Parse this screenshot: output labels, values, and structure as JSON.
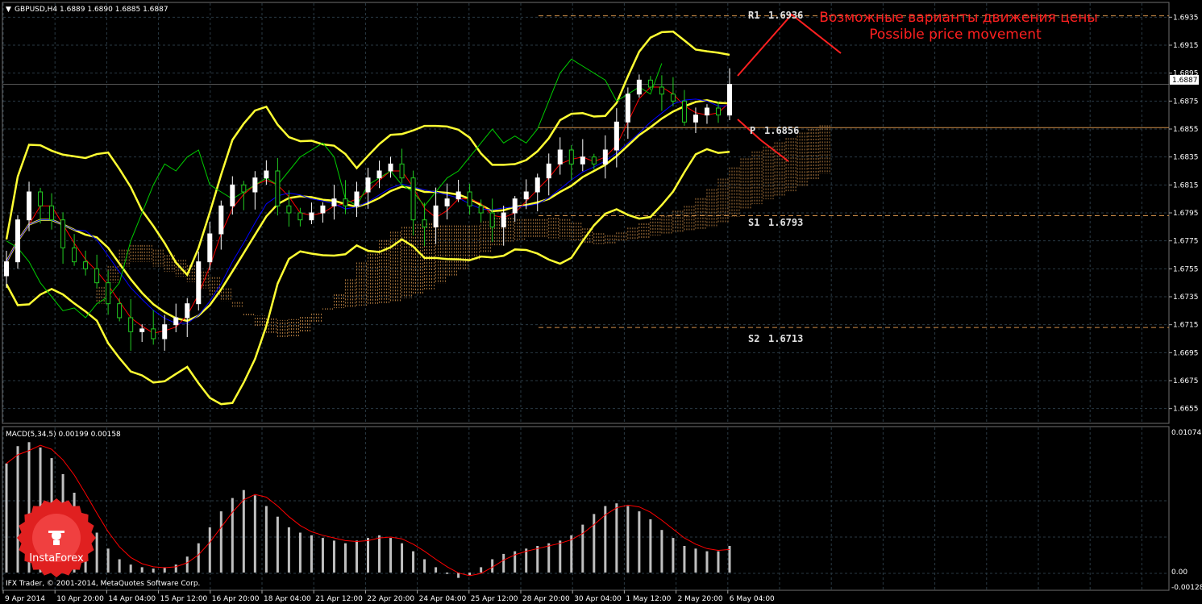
{
  "header": {
    "symbol_info": "GBPUSD,H4  1.6889 1.6890 1.6885 1.6887",
    "menu_glyph": "▼"
  },
  "annotation": {
    "ru": "Возможные варианты движения цены",
    "en": "Possible price movement"
  },
  "levels": [
    {
      "label": "R1",
      "value": "1.6936",
      "price": 1.6936
    },
    {
      "label": "P",
      "value": "1.6856",
      "price": 1.6856
    },
    {
      "label": "S1",
      "value": "1.6793",
      "price": 1.6793
    },
    {
      "label": "S2",
      "value": "1.6713",
      "price": 1.6713
    }
  ],
  "price_axis": {
    "ticks": [
      "1.6935",
      "1.6915",
      "1.6895",
      "1.6875",
      "1.6855",
      "1.6835",
      "1.6815",
      "1.6795",
      "1.6775",
      "1.6755",
      "1.6735",
      "1.6715",
      "1.6695",
      "1.6675",
      "1.6655"
    ],
    "current_price": "1.6887"
  },
  "macd": {
    "label": "MACD(5,34,5) 0.00199 0.00158",
    "axis_max": "0.01074",
    "axis_zero": "0.00",
    "axis_min": "-0.00128"
  },
  "time_axis": [
    "9 Apr 2014",
    "10 Apr 20:00",
    "14 Apr 04:00",
    "15 Apr 12:00",
    "16 Apr 20:00",
    "18 Apr 04:00",
    "21 Apr 12:00",
    "22 Apr 20:00",
    "24 Apr 04:00",
    "25 Apr 12:00",
    "28 Apr 20:00",
    "30 Apr 04:00",
    "1 May 12:00",
    "2 May 20:00",
    "6 May 04:00"
  ],
  "footer": "IFX Trader, © 2001-2014, MetaQuotes Software Corp.",
  "logo": {
    "text": "InstaForex"
  },
  "colors": {
    "background": "#000000",
    "grid": "#2a3a44",
    "bull": "#ffffff",
    "bear": "#22cc22",
    "bollinger": "#ffff33",
    "kijun": "#0000ff",
    "tenkan": "#ff0000",
    "chikou": "#00cc00",
    "cloud": "#d2914a",
    "macd_hist": "#c0c0c0",
    "macd_signal": "#ff0000",
    "annotation": "#ff2020",
    "level_line": "#d2914a"
  },
  "chart_data": {
    "type": "candlestick",
    "symbol": "GBPUSD",
    "timeframe": "H4",
    "ylim": [
      1.6645,
      1.6945
    ],
    "close_path": [
      1.676,
      1.679,
      1.681,
      1.68,
      1.679,
      1.677,
      1.676,
      1.6755,
      1.6745,
      1.673,
      1.672,
      1.671,
      1.6712,
      1.6705,
      1.6715,
      1.672,
      1.673,
      1.676,
      1.678,
      1.68,
      1.6815,
      1.681,
      1.682,
      1.6825,
      1.68,
      1.6795,
      1.679,
      1.6795,
      1.68,
      1.6805,
      1.68,
      1.681,
      1.682,
      1.6825,
      1.683,
      1.682,
      1.679,
      1.6785,
      1.68,
      1.6805,
      1.681,
      1.68,
      1.6795,
      1.6785,
      1.6795,
      1.6805,
      1.681,
      1.682,
      1.683,
      1.684,
      1.683,
      1.6835,
      1.683,
      1.684,
      1.686,
      1.688,
      1.689,
      1.6885,
      1.688,
      1.6875,
      1.686,
      1.6865,
      1.687,
      1.6865,
      1.6887
    ],
    "macd_hist": [
      0.0082,
      0.0095,
      0.0098,
      0.0094,
      0.0086,
      0.0074,
      0.006,
      0.0044,
      0.003,
      0.0018,
      0.001,
      0.0006,
      0.0004,
      0.0003,
      0.0004,
      0.0006,
      0.0012,
      0.0022,
      0.0034,
      0.0046,
      0.0056,
      0.0062,
      0.0058,
      0.005,
      0.0042,
      0.0034,
      0.003,
      0.0028,
      0.0026,
      0.0024,
      0.0022,
      0.0024,
      0.0026,
      0.0028,
      0.0026,
      0.0022,
      0.0016,
      0.001,
      0.0004,
      -0.0001,
      -0.0004,
      -0.0002,
      0.0004,
      0.001,
      0.0014,
      0.0016,
      0.0018,
      0.002,
      0.0022,
      0.0024,
      0.0028,
      0.0036,
      0.0044,
      0.005,
      0.0052,
      0.005,
      0.0046,
      0.004,
      0.0032,
      0.0026,
      0.002,
      0.0018,
      0.0016,
      0.0016,
      0.002
    ],
    "macd_min": -0.00128,
    "macd_max": 0.01074
  }
}
